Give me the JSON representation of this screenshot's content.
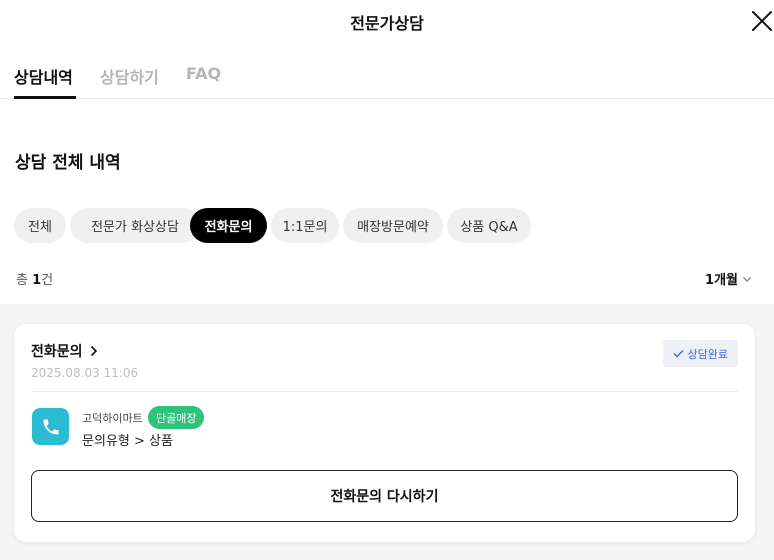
{
  "header": {
    "title": "전문가상담",
    "close_icon": "close-icon"
  },
  "tabs": [
    {
      "label": "상담내역",
      "active": true
    },
    {
      "label": "상담하기",
      "active": false
    },
    {
      "label": "FAQ",
      "active": false
    }
  ],
  "section_title": "상담 전체 내역",
  "filters": [
    {
      "label": "전체",
      "active": false
    },
    {
      "label": "전문가 화상상담",
      "active": false
    },
    {
      "label": "전화문의",
      "active": true
    },
    {
      "label": "1:1문의",
      "active": false
    },
    {
      "label": "매장방문예약",
      "active": false
    },
    {
      "label": "상품 Q&A",
      "active": false
    }
  ],
  "summary": {
    "total_prefix": "총 ",
    "total_count": "1",
    "total_suffix": "건",
    "period": "1개월"
  },
  "card": {
    "title": "전화문의",
    "date": "2025.08.03 11:06",
    "status": "상담완료",
    "status_color": "#3f64e0",
    "store_name": "고덕하이마트",
    "store_badge": "단골매장",
    "store_badge_color": "#2fc27a",
    "icon_color": "#2bbcd3",
    "inquiry_type": "문의유형 > 상품",
    "retry_label": "전화문의 다시하기"
  }
}
